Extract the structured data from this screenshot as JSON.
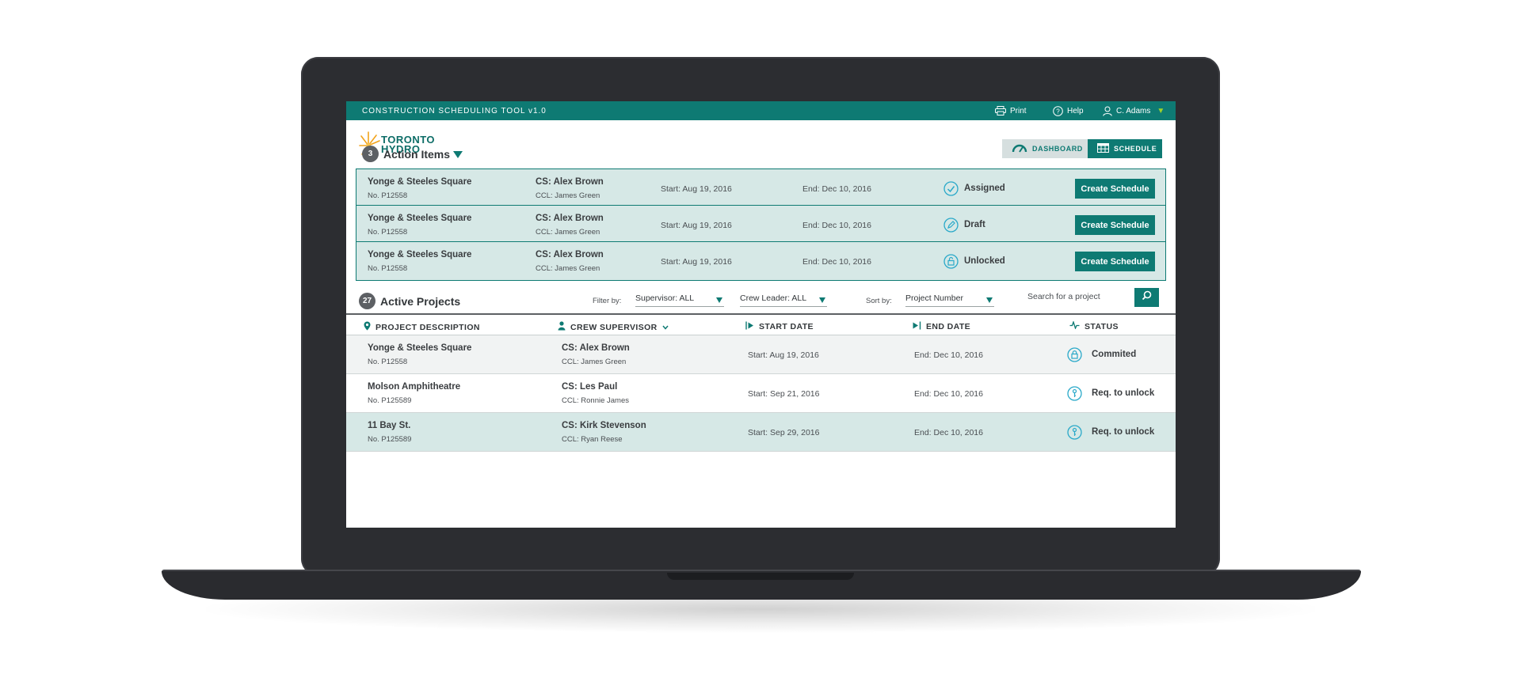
{
  "app": {
    "title": "CONSTRUCTION SCHEDULING TOOL  v1.0",
    "print_label": "Print",
    "help_label": "Help",
    "user_label": "C. Adams"
  },
  "logo": {
    "line1": "TORONTO",
    "line2": "HYDRO"
  },
  "view_toggle": {
    "dashboard_label": "DASHBOARD",
    "schedule_label": "SCHEDULE",
    "active": "SCHEDULE"
  },
  "action_items": {
    "count": "3",
    "title": "Action Items",
    "rows": [
      {
        "name": "Yonge & Steeles Square",
        "number": "No. P12558",
        "supervisor": "CS: Alex Brown",
        "crew_leader": "CCL: James Green",
        "start": "Start: Aug 19, 2016",
        "end": "End: Dec 10, 2016",
        "status": "Assigned",
        "status_icon": "check-circle-icon",
        "button": "Create Schedule"
      },
      {
        "name": "Yonge & Steeles Square",
        "number": "No. P12558",
        "supervisor": "CS: Alex Brown",
        "crew_leader": "CCL: James Green",
        "start": "Start: Aug 19, 2016",
        "end": "End: Dec 10, 2016",
        "status": "Draft",
        "status_icon": "pencil-circle-icon",
        "button": "Create Schedule"
      },
      {
        "name": "Yonge & Steeles Square",
        "number": "No. P12558",
        "supervisor": "CS: Alex Brown",
        "crew_leader": "CCL: James Green",
        "start": "Start: Aug 19, 2016",
        "end": "End: Dec 10, 2016",
        "status": "Unlocked",
        "status_icon": "unlock-circle-icon",
        "button": "Create Schedule"
      }
    ]
  },
  "active_projects": {
    "count": "27",
    "title": "Active Projects",
    "filter_label": "Filter by:",
    "supervisor_filter": "Supervisor: ALL",
    "crew_leader_filter": "Crew Leader: ALL",
    "sort_label": "Sort by:",
    "sort_value": "Project Number",
    "search_placeholder": "Search for a project",
    "columns": {
      "description": "PROJECT DESCRIPTION",
      "supervisor": "CREW SUPERVISOR",
      "start": "START DATE",
      "end": "END DATE",
      "status": "STATUS"
    },
    "rows": [
      {
        "name": "Yonge & Steeles Square",
        "number": "No. P12558",
        "supervisor": "CS: Alex Brown",
        "crew_leader": "CCL: James Green",
        "start": "Start: Aug 19, 2016",
        "end": "End: Dec 10, 2016",
        "status": "Commited",
        "status_icon": "lock-circle-icon"
      },
      {
        "name": "Molson Amphitheatre",
        "number": "No. P125589",
        "supervisor": "CS: Les Paul",
        "crew_leader": "CCL: Ronnie James",
        "start": "Start: Sep 21, 2016",
        "end": "End: Dec 10, 2016",
        "status": "Req. to unlock",
        "status_icon": "key-circle-icon"
      },
      {
        "name": "11 Bay St.",
        "number": "No. P125589",
        "supervisor": "CS: Kirk Stevenson",
        "crew_leader": "CCL: Ryan Reese",
        "start": "Start: Sep 29, 2016",
        "end": "End: Dec 10, 2016",
        "status": "Req. to unlock",
        "status_icon": "key-circle-icon"
      }
    ]
  },
  "colors": {
    "brand_teal": "#0e7a73",
    "row_tint": "#d6e8e6",
    "accent_green": "#9fd22a",
    "status_cyan": "#2aa9c9",
    "logo_orange": "#f2a31b"
  }
}
